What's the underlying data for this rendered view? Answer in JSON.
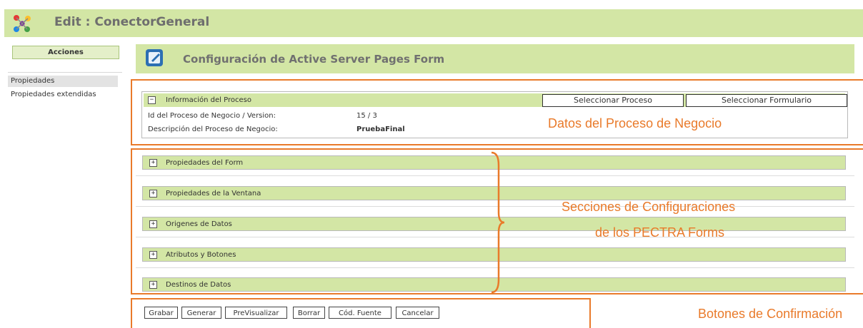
{
  "window": {
    "title": "Edit : ConectorGeneral",
    "logo_icon": "app-logo-icon"
  },
  "sidebar": {
    "header": "Acciones",
    "items": [
      {
        "label": "Propiedades"
      },
      {
        "label": "Propiedades extendidas"
      }
    ]
  },
  "main": {
    "title": "Configuración de Active Server Pages Form",
    "icon": "edit-form-icon"
  },
  "process": {
    "label": "Información del Proceso",
    "toggle": "−",
    "select_process": "Seleccionar Proceso",
    "select_form": "Seleccionar Formulario",
    "rows": [
      {
        "label": "Id del Proceso de Negocio / Version:",
        "value": "15 / 3"
      },
      {
        "label": "Descripción del Proceso de Negocio:",
        "value": "PruebaFinal"
      }
    ]
  },
  "sections": [
    {
      "label": "Propiedades del Form",
      "toggle": "+"
    },
    {
      "label": "Propiedades de la Ventana",
      "toggle": "+"
    },
    {
      "label": "Origenes de Datos",
      "toggle": "+"
    },
    {
      "label": "Atributos y Botones",
      "toggle": "+"
    },
    {
      "label": "Destinos de Datos",
      "toggle": "+"
    }
  ],
  "buttons": {
    "grabar": "Grabar",
    "generar": "Generar",
    "previsualizar": "PreVisualizar",
    "borrar": "Borrar",
    "cod_fuente": "Cód. Fuente",
    "cancelar": "Cancelar"
  },
  "annotations": {
    "datos": "Datos del Proceso de Negocio",
    "secciones_line1": "Secciones de Configuraciones",
    "secciones_line2": "de los PECTRA Forms",
    "botones": "Botones de Confirmación"
  },
  "colors": {
    "bar_green": "#d3e6a5",
    "annotation_orange": "#e97a2a"
  }
}
